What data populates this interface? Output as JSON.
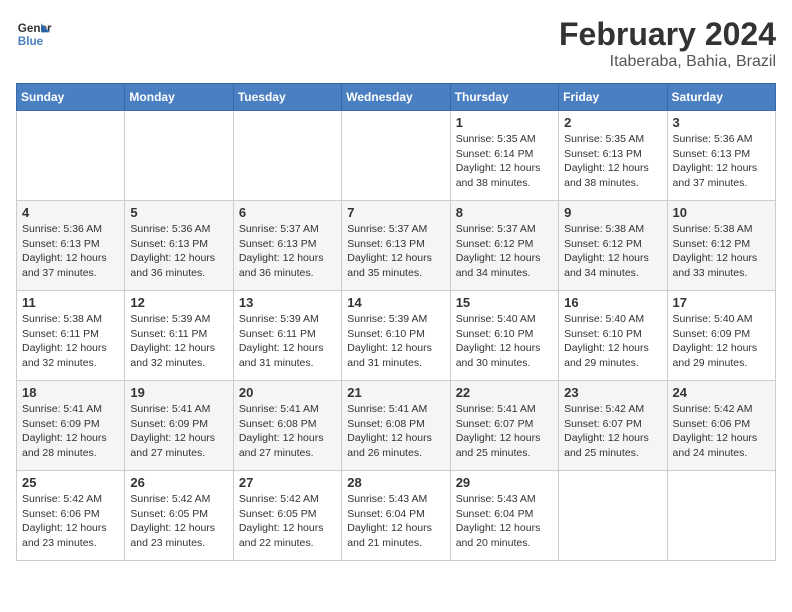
{
  "logo": {
    "line1": "General",
    "line2": "Blue"
  },
  "title": "February 2024",
  "location": "Itaberaba, Bahia, Brazil",
  "days_of_week": [
    "Sunday",
    "Monday",
    "Tuesday",
    "Wednesday",
    "Thursday",
    "Friday",
    "Saturday"
  ],
  "weeks": [
    [
      {
        "day": "",
        "info": ""
      },
      {
        "day": "",
        "info": ""
      },
      {
        "day": "",
        "info": ""
      },
      {
        "day": "",
        "info": ""
      },
      {
        "day": "1",
        "sunrise": "5:35 AM",
        "sunset": "6:14 PM",
        "daylight": "12 hours and 38 minutes."
      },
      {
        "day": "2",
        "sunrise": "5:35 AM",
        "sunset": "6:13 PM",
        "daylight": "12 hours and 38 minutes."
      },
      {
        "day": "3",
        "sunrise": "5:36 AM",
        "sunset": "6:13 PM",
        "daylight": "12 hours and 37 minutes."
      }
    ],
    [
      {
        "day": "4",
        "sunrise": "5:36 AM",
        "sunset": "6:13 PM",
        "daylight": "12 hours and 37 minutes."
      },
      {
        "day": "5",
        "sunrise": "5:36 AM",
        "sunset": "6:13 PM",
        "daylight": "12 hours and 36 minutes."
      },
      {
        "day": "6",
        "sunrise": "5:37 AM",
        "sunset": "6:13 PM",
        "daylight": "12 hours and 36 minutes."
      },
      {
        "day": "7",
        "sunrise": "5:37 AM",
        "sunset": "6:13 PM",
        "daylight": "12 hours and 35 minutes."
      },
      {
        "day": "8",
        "sunrise": "5:37 AM",
        "sunset": "6:12 PM",
        "daylight": "12 hours and 34 minutes."
      },
      {
        "day": "9",
        "sunrise": "5:38 AM",
        "sunset": "6:12 PM",
        "daylight": "12 hours and 34 minutes."
      },
      {
        "day": "10",
        "sunrise": "5:38 AM",
        "sunset": "6:12 PM",
        "daylight": "12 hours and 33 minutes."
      }
    ],
    [
      {
        "day": "11",
        "sunrise": "5:38 AM",
        "sunset": "6:11 PM",
        "daylight": "12 hours and 32 minutes."
      },
      {
        "day": "12",
        "sunrise": "5:39 AM",
        "sunset": "6:11 PM",
        "daylight": "12 hours and 32 minutes."
      },
      {
        "day": "13",
        "sunrise": "5:39 AM",
        "sunset": "6:11 PM",
        "daylight": "12 hours and 31 minutes."
      },
      {
        "day": "14",
        "sunrise": "5:39 AM",
        "sunset": "6:10 PM",
        "daylight": "12 hours and 31 minutes."
      },
      {
        "day": "15",
        "sunrise": "5:40 AM",
        "sunset": "6:10 PM",
        "daylight": "12 hours and 30 minutes."
      },
      {
        "day": "16",
        "sunrise": "5:40 AM",
        "sunset": "6:10 PM",
        "daylight": "12 hours and 29 minutes."
      },
      {
        "day": "17",
        "sunrise": "5:40 AM",
        "sunset": "6:09 PM",
        "daylight": "12 hours and 29 minutes."
      }
    ],
    [
      {
        "day": "18",
        "sunrise": "5:41 AM",
        "sunset": "6:09 PM",
        "daylight": "12 hours and 28 minutes."
      },
      {
        "day": "19",
        "sunrise": "5:41 AM",
        "sunset": "6:09 PM",
        "daylight": "12 hours and 27 minutes."
      },
      {
        "day": "20",
        "sunrise": "5:41 AM",
        "sunset": "6:08 PM",
        "daylight": "12 hours and 27 minutes."
      },
      {
        "day": "21",
        "sunrise": "5:41 AM",
        "sunset": "6:08 PM",
        "daylight": "12 hours and 26 minutes."
      },
      {
        "day": "22",
        "sunrise": "5:41 AM",
        "sunset": "6:07 PM",
        "daylight": "12 hours and 25 minutes."
      },
      {
        "day": "23",
        "sunrise": "5:42 AM",
        "sunset": "6:07 PM",
        "daylight": "12 hours and 25 minutes."
      },
      {
        "day": "24",
        "sunrise": "5:42 AM",
        "sunset": "6:06 PM",
        "daylight": "12 hours and 24 minutes."
      }
    ],
    [
      {
        "day": "25",
        "sunrise": "5:42 AM",
        "sunset": "6:06 PM",
        "daylight": "12 hours and 23 minutes."
      },
      {
        "day": "26",
        "sunrise": "5:42 AM",
        "sunset": "6:05 PM",
        "daylight": "12 hours and 23 minutes."
      },
      {
        "day": "27",
        "sunrise": "5:42 AM",
        "sunset": "6:05 PM",
        "daylight": "12 hours and 22 minutes."
      },
      {
        "day": "28",
        "sunrise": "5:43 AM",
        "sunset": "6:04 PM",
        "daylight": "12 hours and 21 minutes."
      },
      {
        "day": "29",
        "sunrise": "5:43 AM",
        "sunset": "6:04 PM",
        "daylight": "12 hours and 20 minutes."
      },
      {
        "day": "",
        "info": ""
      },
      {
        "day": "",
        "info": ""
      }
    ]
  ]
}
